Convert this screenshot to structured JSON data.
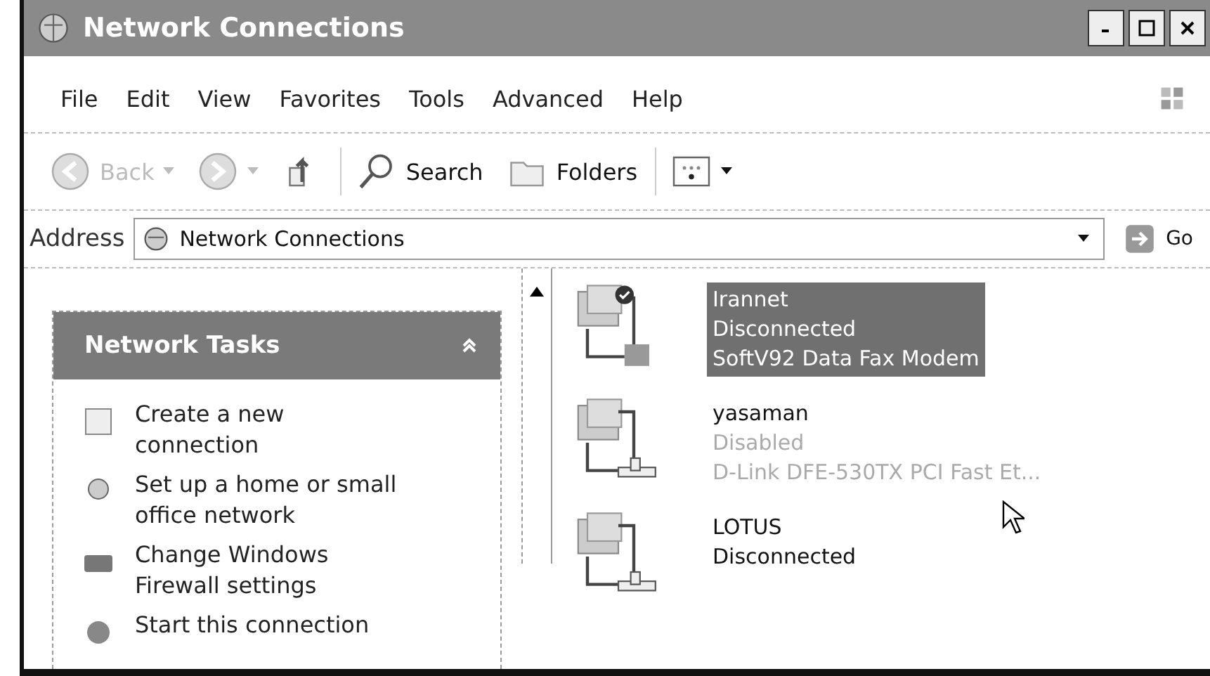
{
  "window": {
    "title": "Network Connections"
  },
  "menu": [
    "File",
    "Edit",
    "View",
    "Favorites",
    "Tools",
    "Advanced",
    "Help"
  ],
  "toolbar": [
    {
      "kind": "back",
      "label": "Back",
      "disabled": true
    },
    {
      "kind": "forward",
      "disabled": true
    },
    {
      "kind": "up"
    },
    {
      "kind": "search",
      "label": "Search"
    },
    {
      "kind": "folders",
      "label": "Folders"
    },
    {
      "kind": "views"
    }
  ],
  "address": {
    "label": "Address",
    "value": "Network Connections",
    "go": "Go"
  },
  "tasks": {
    "title": "Network Tasks",
    "expanded": true,
    "items": [
      "Create a new connection",
      "Set up a home or small office network",
      "Change Windows Firewall settings",
      "Start this connection"
    ]
  },
  "connections": [
    {
      "name": "Irannet",
      "status": "Disconnected",
      "device": "SoftV92 Data Fax Modem",
      "selected": true,
      "disabled": false,
      "kind": "dialup"
    },
    {
      "name": "yasaman",
      "status": "Disabled",
      "device": "D-Link DFE-530TX PCI Fast Et...",
      "selected": false,
      "disabled": true,
      "kind": "lan"
    },
    {
      "name": "LOTUS",
      "status": "Disconnected",
      "selected": false,
      "disabled": false,
      "kind": "lan"
    }
  ]
}
